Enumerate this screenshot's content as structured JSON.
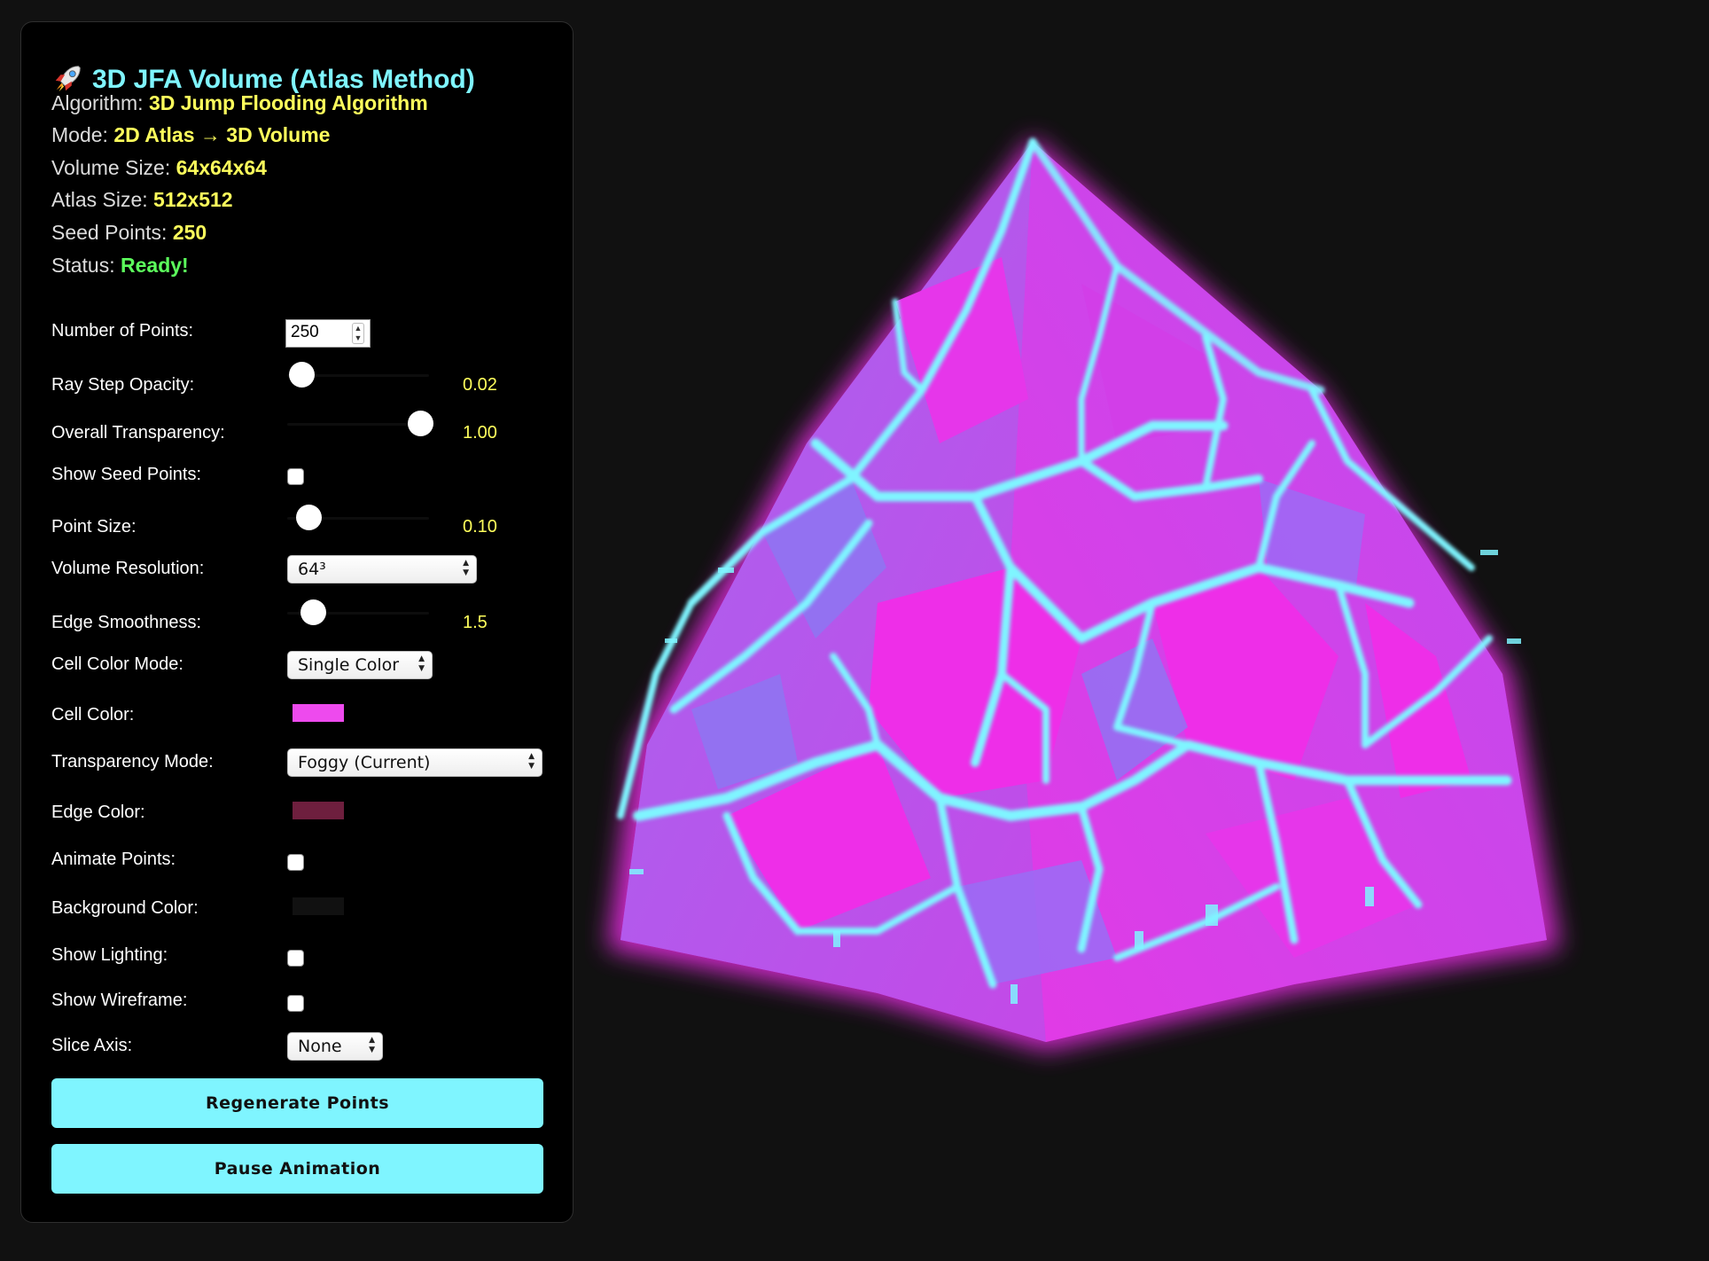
{
  "panel": {
    "title": "3D JFA Volume (Atlas Method)",
    "title_icon": "rocket-icon",
    "info": [
      {
        "label": "Algorithm:",
        "value": "3D Jump Flooding Algorithm"
      },
      {
        "label": "Mode:",
        "value": "2D Atlas → 3D Volume"
      },
      {
        "label": "Volume Size:",
        "value": "64x64x64"
      },
      {
        "label": "Atlas Size:",
        "value": "512x512"
      },
      {
        "label": "Seed Points:",
        "value": "250"
      },
      {
        "label": "Status:",
        "value": "Ready!"
      }
    ]
  },
  "controls": {
    "num_points": {
      "label": "Number of Points:",
      "value": "250"
    },
    "ray_step_opacity": {
      "label": "Ray Step Opacity:",
      "value_text": "0.02",
      "fraction": 0.1
    },
    "overall_transparency": {
      "label": "Overall Transparency:",
      "value_text": "1.00",
      "fraction": 0.94
    },
    "show_seed_points": {
      "label": "Show Seed Points:",
      "checked": false
    },
    "point_size": {
      "label": "Point Size:",
      "value_text": "0.10",
      "fraction": 0.15
    },
    "volume_resolution": {
      "label": "Volume Resolution:",
      "selected": "64³"
    },
    "edge_smoothness": {
      "label": "Edge Smoothness:",
      "value_text": "1.5",
      "fraction": 0.18
    },
    "cell_color_mode": {
      "label": "Cell Color Mode:",
      "selected": "Single Color"
    },
    "cell_color": {
      "label": "Cell Color:",
      "color": "#ee4aee"
    },
    "transparency_mode": {
      "label": "Transparency Mode:",
      "selected": "Foggy (Current)"
    },
    "edge_color": {
      "label": "Edge Color:",
      "color": "#6e1f3e"
    },
    "animate_points": {
      "label": "Animate Points:",
      "checked": false
    },
    "background_color": {
      "label": "Background Color:",
      "color": "#111111"
    },
    "show_lighting": {
      "label": "Show Lighting:",
      "checked": false
    },
    "show_wireframe": {
      "label": "Show Wireframe:",
      "checked": false
    },
    "slice_axis": {
      "label": "Slice Axis:",
      "selected": "None"
    },
    "regenerate_button": "Regenerate Points",
    "pause_button": "Pause Animation"
  },
  "colors": {
    "accent": "#7ff5ff",
    "value": "#ffff5c",
    "ready": "#5cff5c",
    "magenta": "#ee2ee8",
    "cyan_edge": "#7ff5ff",
    "violet": "#9a6cf5"
  }
}
